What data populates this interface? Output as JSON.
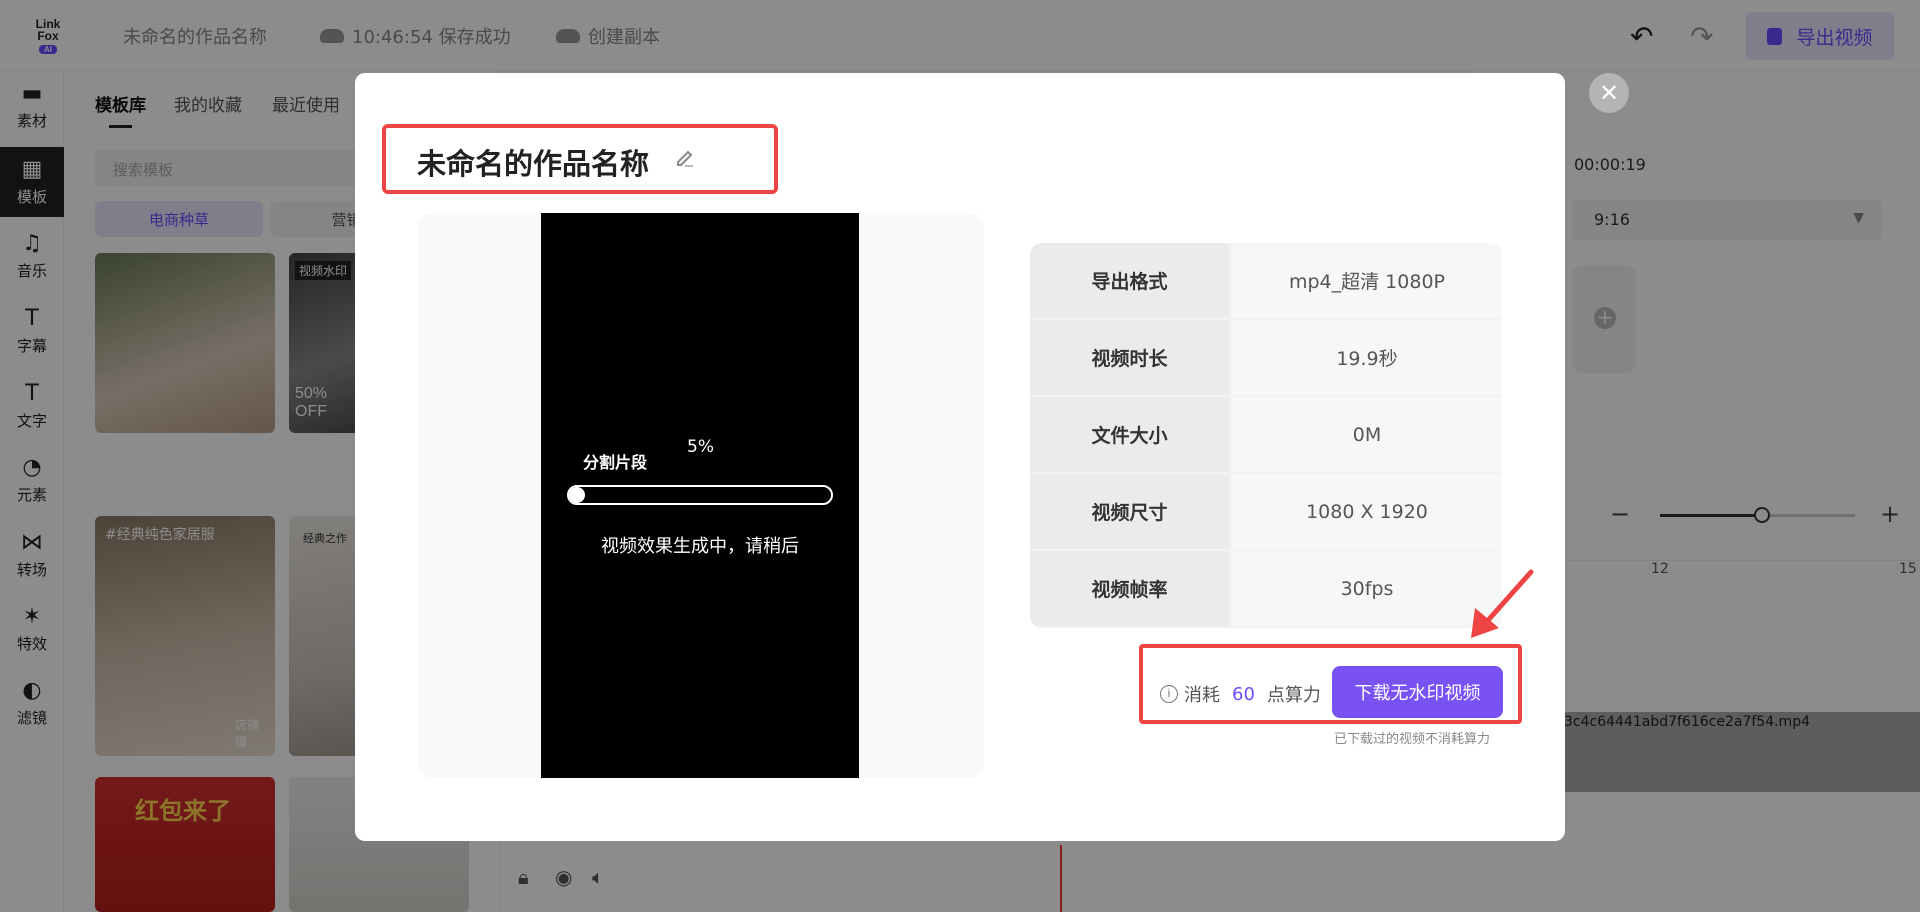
{
  "app": {
    "logo_line1": "Link",
    "logo_line2": "Fox",
    "logo_ai": "AI",
    "project_name": "未命名的作品名称",
    "save_status": "10:46:54 保存成功",
    "create_copy": "创建副本",
    "export_label": "导出视频"
  },
  "leftnav": [
    {
      "label": "素材",
      "icon": "folder-icon"
    },
    {
      "label": "模板",
      "icon": "template-icon"
    },
    {
      "label": "音乐",
      "icon": "music-icon"
    },
    {
      "label": "字幕",
      "icon": "subtitle-icon"
    },
    {
      "label": "文字",
      "icon": "text-icon"
    },
    {
      "label": "元素",
      "icon": "element-icon"
    },
    {
      "label": "转场",
      "icon": "transition-icon"
    },
    {
      "label": "特效",
      "icon": "effect-icon"
    },
    {
      "label": "滤镜",
      "icon": "filter-icon"
    }
  ],
  "panel": {
    "tabs": [
      "模板库",
      "我的收藏",
      "最近使用"
    ],
    "search_placeholder": "搜索模板",
    "categories": [
      "电商种草",
      "营销短"
    ],
    "thumb_texts": {
      "t1": "视频水印",
      "t2": "50% OFF",
      "t3": "#经典纯色家居服",
      "t4": "经典之作",
      "t5": "店铺爆",
      "t6": "红包来了"
    }
  },
  "right_panel": {
    "duration": "00:00:19",
    "ratio": "9:16",
    "tick_12": "12",
    "tick_15": "15",
    "clip_name": "3c4c64441abd7f616ce2a7f54.mp4"
  },
  "modal": {
    "title": "未命名的作品名称",
    "segment_label": "分割片段",
    "progress_text": "5%",
    "progress_value": 0.05,
    "generating_text": "视频效果生成中，请稍后",
    "info": [
      {
        "key": "导出格式",
        "value": "mp4_超清 1080P"
      },
      {
        "key": "视频时长",
        "value": "19.9秒"
      },
      {
        "key": "文件大小",
        "value": "0M"
      },
      {
        "key": "视频尺寸",
        "value": "1080 X 1920"
      },
      {
        "key": "视频帧率",
        "value": "30fps"
      }
    ],
    "cost_prefix": "消耗",
    "cost_value": "60",
    "cost_suffix": "点算力",
    "download_label": "下载无水印视频",
    "note": "已下载过的视频不消耗算力"
  },
  "colors": {
    "accent": "#7a52f4",
    "highlight": "#ef4444"
  }
}
